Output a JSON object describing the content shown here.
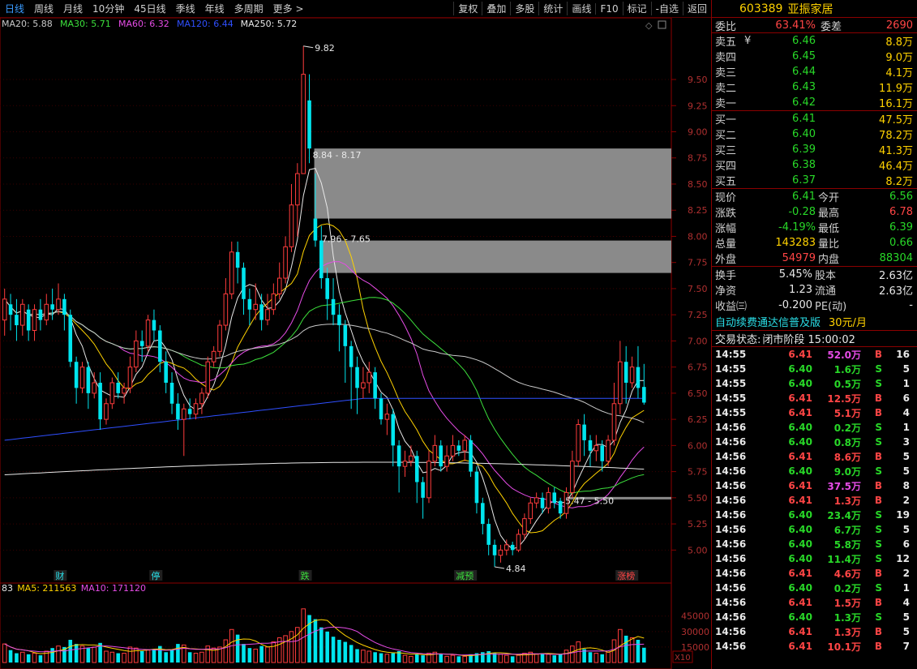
{
  "topbar": {
    "periods": [
      "日线",
      "周线",
      "月线",
      "10分钟",
      "45日线",
      "季线",
      "年线",
      "多周期",
      "更多 >"
    ],
    "tools": [
      "复权",
      "叠加",
      "多股",
      "统计",
      "画线",
      "F10",
      "标记",
      "-自选",
      "返回"
    ]
  },
  "indicators": {
    "main": [
      {
        "label": "MA20: 5.88",
        "color": "#c8c8c8"
      },
      {
        "label": "MA30: 5.71",
        "color": "#3ce03c"
      },
      {
        "label": "MA60: 6.32",
        "color": "#e64ce6"
      },
      {
        "label": "MA120: 6.44",
        "color": "#2f4fff"
      },
      {
        "label": "MA250: 5.72",
        "color": "#e8e8e8"
      }
    ],
    "volume": [
      {
        "label": "83",
        "color": "#e8e8e8"
      },
      {
        "label": "MA5: 211563",
        "color": "#ffd200"
      },
      {
        "label": "MA10: 171120",
        "color": "#e64ce6"
      }
    ]
  },
  "price_axis": [
    "9.50",
    "9.25",
    "9.00",
    "8.75",
    "8.50",
    "8.25",
    "8.00",
    "7.75",
    "7.50",
    "7.25",
    "7.00",
    "6.75",
    "6.50",
    "6.25",
    "6.00",
    "5.75",
    "5.50",
    "5.25",
    "5.00"
  ],
  "volume_axis": [
    "45000",
    "30000",
    "15000"
  ],
  "volume_unit": "X10",
  "annotations": {
    "high": "9.82",
    "low": "4.84",
    "gaps": [
      "8.84 - 8.17",
      "7.96 - 7.65",
      "5.47 - 5.50"
    ]
  },
  "event_tags": [
    "财",
    "停",
    "跌",
    "减预",
    "涨榜"
  ],
  "chart_data": {
    "type": "candlestick",
    "price_range": [
      4.7,
      9.95
    ],
    "volume_range": [
      0,
      55000
    ],
    "candles": [
      [
        7.2,
        7.4,
        7.5,
        7.05,
        18000
      ],
      [
        7.35,
        7.25,
        7.45,
        7.1,
        12000
      ],
      [
        7.25,
        7.15,
        7.4,
        7.0,
        9000
      ],
      [
        7.15,
        7.35,
        7.4,
        7.05,
        10000
      ],
      [
        7.3,
        7.1,
        7.35,
        7.0,
        8000
      ],
      [
        7.1,
        7.3,
        7.35,
        7.0,
        9000
      ],
      [
        7.3,
        7.2,
        7.4,
        7.1,
        7000
      ],
      [
        7.2,
        7.35,
        7.45,
        7.15,
        11000
      ],
      [
        7.35,
        7.3,
        7.5,
        7.2,
        14000
      ],
      [
        7.3,
        7.4,
        7.55,
        7.25,
        16000
      ],
      [
        7.4,
        7.25,
        7.45,
        7.1,
        15000
      ],
      [
        7.25,
        6.8,
        7.3,
        6.75,
        22000
      ],
      [
        6.8,
        6.55,
        6.85,
        6.4,
        18000
      ],
      [
        6.55,
        6.75,
        6.8,
        6.5,
        16000
      ],
      [
        6.75,
        6.5,
        6.8,
        6.35,
        14000
      ],
      [
        6.5,
        6.6,
        6.7,
        6.45,
        15000
      ],
      [
        6.6,
        6.25,
        6.7,
        6.15,
        19000
      ],
      [
        6.25,
        6.4,
        6.45,
        6.2,
        11000
      ],
      [
        6.4,
        6.6,
        6.65,
        6.35,
        10000
      ],
      [
        6.6,
        6.5,
        6.7,
        6.45,
        9000
      ],
      [
        6.5,
        6.55,
        6.6,
        6.4,
        9000
      ],
      [
        6.55,
        6.75,
        6.85,
        6.5,
        15000
      ],
      [
        6.75,
        7.0,
        7.1,
        6.7,
        14000
      ],
      [
        7.0,
        6.95,
        7.1,
        6.8,
        11000
      ],
      [
        6.95,
        7.2,
        7.25,
        6.9,
        12000
      ],
      [
        7.2,
        7.1,
        7.3,
        7.0,
        13000
      ],
      [
        7.1,
        6.8,
        7.15,
        6.7,
        16000
      ],
      [
        6.8,
        6.6,
        6.9,
        6.5,
        10000
      ],
      [
        6.6,
        6.4,
        6.7,
        6.3,
        12000
      ],
      [
        6.4,
        6.25,
        6.5,
        6.15,
        18000
      ],
      [
        6.25,
        6.35,
        6.4,
        5.9,
        17000
      ],
      [
        6.35,
        6.3,
        6.45,
        6.25,
        10000
      ],
      [
        6.3,
        6.4,
        6.45,
        6.25,
        9000
      ],
      [
        6.4,
        6.5,
        6.55,
        6.3,
        10000
      ],
      [
        6.5,
        6.8,
        6.85,
        6.45,
        16000
      ],
      [
        6.8,
        6.9,
        6.95,
        6.75,
        14000
      ],
      [
        6.9,
        7.15,
        7.2,
        6.85,
        15000
      ],
      [
        7.15,
        7.45,
        7.6,
        7.1,
        22000
      ],
      [
        7.45,
        7.85,
        7.95,
        7.4,
        32000
      ],
      [
        7.85,
        7.7,
        7.95,
        7.55,
        27000
      ],
      [
        7.7,
        7.4,
        7.75,
        7.25,
        18000
      ],
      [
        7.4,
        7.3,
        7.5,
        7.15,
        14000
      ],
      [
        7.3,
        7.35,
        7.55,
        7.2,
        13000
      ],
      [
        7.35,
        7.2,
        7.45,
        7.1,
        16000
      ],
      [
        7.2,
        7.3,
        7.45,
        7.15,
        15000
      ],
      [
        7.3,
        7.45,
        7.55,
        7.25,
        20000
      ],
      [
        7.45,
        7.6,
        7.75,
        7.4,
        24000
      ],
      [
        7.6,
        7.9,
        8.0,
        7.55,
        26000
      ],
      [
        7.9,
        8.3,
        8.5,
        7.85,
        30000
      ],
      [
        8.3,
        8.6,
        8.7,
        8.0,
        34000
      ],
      [
        8.6,
        9.55,
        9.82,
        8.6,
        52000
      ],
      [
        9.3,
        8.84,
        9.55,
        8.7,
        46000
      ],
      [
        8.17,
        7.96,
        8.6,
        7.9,
        42000
      ],
      [
        7.96,
        7.6,
        8.1,
        7.5,
        34000
      ],
      [
        7.6,
        7.4,
        7.7,
        7.2,
        30000
      ],
      [
        7.4,
        7.25,
        7.6,
        7.15,
        25000
      ],
      [
        7.25,
        7.15,
        7.35,
        6.9,
        22000
      ],
      [
        7.15,
        6.95,
        7.2,
        6.6,
        20000
      ],
      [
        6.95,
        6.75,
        7.0,
        6.35,
        17000
      ],
      [
        6.75,
        6.55,
        6.85,
        6.3,
        13000
      ],
      [
        6.55,
        6.6,
        6.75,
        6.45,
        12000
      ],
      [
        6.6,
        6.7,
        6.8,
        6.5,
        11000
      ],
      [
        6.7,
        6.45,
        6.75,
        6.35,
        10000
      ],
      [
        6.45,
        6.25,
        6.5,
        6.2,
        9000
      ],
      [
        6.25,
        6.3,
        6.4,
        6.1,
        8000
      ],
      [
        6.3,
        6.0,
        6.35,
        5.8,
        9000
      ],
      [
        6.0,
        5.8,
        6.05,
        5.55,
        11000
      ],
      [
        5.8,
        5.85,
        5.95,
        5.7,
        7000
      ],
      [
        5.85,
        5.9,
        6.0,
        5.8,
        6000
      ],
      [
        5.9,
        5.65,
        5.95,
        5.45,
        8000
      ],
      [
        5.65,
        5.5,
        5.7,
        5.3,
        7000
      ],
      [
        5.5,
        5.85,
        5.95,
        5.45,
        9000
      ],
      [
        5.85,
        6.0,
        6.1,
        5.8,
        10000
      ],
      [
        6.0,
        5.8,
        6.05,
        5.75,
        8000
      ],
      [
        5.8,
        5.9,
        6.0,
        5.75,
        6000
      ],
      [
        5.9,
        6.0,
        6.1,
        5.85,
        7000
      ],
      [
        6.0,
        5.95,
        6.05,
        5.9,
        6000
      ],
      [
        5.95,
        6.05,
        6.1,
        5.85,
        6000
      ],
      [
        6.05,
        5.75,
        6.1,
        5.7,
        8000
      ],
      [
        5.75,
        5.45,
        5.8,
        5.35,
        9000
      ],
      [
        5.45,
        5.25,
        5.5,
        5.15,
        10000
      ],
      [
        5.25,
        5.05,
        5.3,
        4.95,
        11000
      ],
      [
        5.05,
        4.95,
        5.1,
        4.84,
        9000
      ],
      [
        4.95,
        5.0,
        5.05,
        4.88,
        8000
      ],
      [
        5.0,
        5.05,
        5.1,
        4.95,
        7000
      ],
      [
        5.05,
        5.0,
        5.08,
        4.95,
        6000
      ],
      [
        5.0,
        5.15,
        5.2,
        4.98,
        7000
      ],
      [
        5.15,
        5.3,
        5.35,
        5.1,
        9000
      ],
      [
        5.3,
        5.45,
        5.5,
        5.25,
        10000
      ],
      [
        5.45,
        5.5,
        5.55,
        5.4,
        8000
      ],
      [
        5.5,
        5.4,
        5.55,
        5.35,
        9000
      ],
      [
        5.4,
        5.55,
        5.6,
        5.35,
        8000
      ],
      [
        5.55,
        5.45,
        5.6,
        5.4,
        7000
      ],
      [
        5.47,
        5.35,
        5.5,
        5.3,
        8000
      ],
      [
        5.35,
        5.55,
        5.6,
        5.3,
        12000
      ],
      [
        5.55,
        5.85,
        5.95,
        5.5,
        16000
      ],
      [
        5.85,
        6.2,
        6.25,
        5.8,
        20000
      ],
      [
        6.2,
        6.05,
        6.3,
        5.9,
        13000
      ],
      [
        6.05,
        5.95,
        6.1,
        5.8,
        10000
      ],
      [
        5.95,
        6.0,
        6.1,
        5.85,
        9000
      ],
      [
        6.0,
        5.85,
        6.05,
        5.75,
        8000
      ],
      [
        5.85,
        6.05,
        6.1,
        5.8,
        10000
      ],
      [
        6.05,
        6.4,
        6.6,
        6.0,
        22000
      ],
      [
        6.4,
        6.8,
        7.0,
        6.3,
        32000
      ],
      [
        6.8,
        6.6,
        6.95,
        6.4,
        26000
      ],
      [
        6.6,
        6.75,
        6.85,
        6.55,
        24000
      ],
      [
        6.75,
        6.55,
        6.95,
        6.45,
        22000
      ],
      [
        6.56,
        6.41,
        6.78,
        6.39,
        14328
      ]
    ]
  },
  "quote": {
    "code": "603389",
    "name": "亚振家居",
    "weibi_label": "委比",
    "weibi_value": "63.41%",
    "weicha_label": "委差",
    "weicha_value": "2690",
    "asks": [
      {
        "label": "卖五",
        "price": "6.46",
        "vol": "8.8万"
      },
      {
        "label": "卖四",
        "price": "6.45",
        "vol": "9.0万"
      },
      {
        "label": "卖三",
        "price": "6.44",
        "vol": "4.1万"
      },
      {
        "label": "卖二",
        "price": "6.43",
        "vol": "11.9万"
      },
      {
        "label": "卖一",
        "price": "6.42",
        "vol": "16.1万"
      }
    ],
    "ask_currency": "¥",
    "bids": [
      {
        "label": "买一",
        "price": "6.41",
        "vol": "47.5万"
      },
      {
        "label": "买二",
        "price": "6.40",
        "vol": "78.2万"
      },
      {
        "label": "买三",
        "price": "6.39",
        "vol": "41.3万"
      },
      {
        "label": "买四",
        "price": "6.38",
        "vol": "46.4万"
      },
      {
        "label": "买五",
        "price": "6.37",
        "vol": "8.2万"
      }
    ],
    "stats": [
      {
        "l1": "现价",
        "v1": "6.41",
        "c1": "grn",
        "l2": "今开",
        "v2": "6.56",
        "c2": "grn"
      },
      {
        "l1": "涨跌",
        "v1": "-0.28",
        "c1": "grn",
        "l2": "最高",
        "v2": "6.78",
        "c2": "red"
      },
      {
        "l1": "涨幅",
        "v1": "-4.19%",
        "c1": "grn",
        "l2": "最低",
        "v2": "6.39",
        "c2": "grn"
      },
      {
        "l1": "总量",
        "v1": "143283",
        "c1": "yel",
        "l2": "量比",
        "v2": "0.66",
        "c2": "grn"
      },
      {
        "l1": "外盘",
        "v1": "54979",
        "c1": "red",
        "l2": "内盘",
        "v2": "88304",
        "c2": "grn"
      }
    ],
    "stats2": [
      {
        "l1": "换手",
        "v1": "5.45%",
        "l2": "股本",
        "v2": "2.63亿"
      },
      {
        "l1": "净资",
        "v1": "1.23",
        "l2": "流通",
        "v2": "2.63亿"
      },
      {
        "l1": "收益㈢",
        "v1": "-0.200",
        "l2": "PE(动)",
        "v2": "-"
      }
    ],
    "ad_text": "自动续费通达信普及版",
    "ad_price": "30元/月",
    "trade_status_label": "交易状态:",
    "trade_status_value": "闭市阶段 15:00:02",
    "ticks": [
      [
        "14:55",
        "6.41",
        "52.0万",
        "B",
        "16"
      ],
      [
        "14:55",
        "6.40",
        "1.6万",
        "S",
        "5"
      ],
      [
        "14:55",
        "6.40",
        "0.5万",
        "S",
        "1"
      ],
      [
        "14:55",
        "6.41",
        "12.5万",
        "B",
        "6"
      ],
      [
        "14:55",
        "6.41",
        "5.1万",
        "B",
        "4"
      ],
      [
        "14:56",
        "6.40",
        "0.2万",
        "S",
        "1"
      ],
      [
        "14:56",
        "6.40",
        "0.8万",
        "S",
        "3"
      ],
      [
        "14:56",
        "6.41",
        "8.6万",
        "B",
        "5"
      ],
      [
        "14:56",
        "6.40",
        "9.0万",
        "S",
        "5"
      ],
      [
        "14:56",
        "6.41",
        "37.5万",
        "B",
        "8"
      ],
      [
        "14:56",
        "6.41",
        "1.3万",
        "B",
        "2"
      ],
      [
        "14:56",
        "6.40",
        "23.4万",
        "S",
        "19"
      ],
      [
        "14:56",
        "6.40",
        "6.7万",
        "S",
        "5"
      ],
      [
        "14:56",
        "6.40",
        "5.8万",
        "S",
        "6"
      ],
      [
        "14:56",
        "6.40",
        "11.4万",
        "S",
        "12"
      ],
      [
        "14:56",
        "6.41",
        "4.6万",
        "B",
        "2"
      ],
      [
        "14:56",
        "6.40",
        "0.2万",
        "S",
        "1"
      ],
      [
        "14:56",
        "6.41",
        "1.5万",
        "B",
        "4"
      ],
      [
        "14:56",
        "6.40",
        "1.3万",
        "S",
        "5"
      ],
      [
        "14:56",
        "6.41",
        "1.3万",
        "B",
        "5"
      ],
      [
        "14:56",
        "6.41",
        "10.1万",
        "B",
        "7"
      ]
    ]
  }
}
